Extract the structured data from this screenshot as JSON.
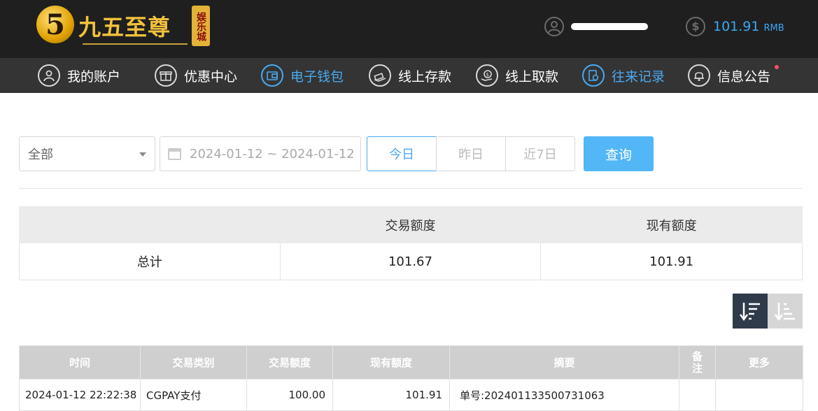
{
  "header": {
    "logo_mark": "5",
    "logo_text": "九五至尊",
    "logo_tag": "娱乐城",
    "balance": "101.91",
    "currency": "RMB"
  },
  "nav": {
    "items": [
      {
        "label": "我的账户",
        "icon": "user-icon",
        "active": false
      },
      {
        "label": "优惠中心",
        "icon": "gift-icon",
        "active": false
      },
      {
        "label": "电子钱包",
        "icon": "wallet-icon",
        "active": true
      },
      {
        "label": "线上存款",
        "icon": "deposit-icon",
        "active": false
      },
      {
        "label": "线上取款",
        "icon": "withdraw-icon",
        "active": false
      },
      {
        "label": "往来记录",
        "icon": "records-icon",
        "active": true
      },
      {
        "label": "信息公告",
        "icon": "bell-icon",
        "active": false
      }
    ]
  },
  "filter": {
    "type_selected": "全部",
    "date_range": "2024-01-12 ~ 2024-01-12",
    "quick": [
      "今日",
      "昨日",
      "近7日"
    ],
    "quick_active": 0,
    "query_label": "查询"
  },
  "summary": {
    "headers": [
      "",
      "交易额度",
      "现有额度"
    ],
    "row": [
      "总计",
      "101.67",
      "101.91"
    ]
  },
  "records": {
    "headers": [
      "时间",
      "交易类别",
      "交易额度",
      "现有额度",
      "摘要",
      "备注",
      "更多"
    ],
    "rows": [
      [
        "2024-01-12 22:22:38",
        "CGPAY支付",
        "100.00",
        "101.91",
        "单号:202401133500731063",
        "",
        ""
      ]
    ]
  },
  "colors": {
    "accent": "#4aa9f0",
    "header_bg": "#1f1f1f",
    "nav_bg": "#343434",
    "query_button": "#52b6f7",
    "sort_active": "#2f3a4b"
  }
}
